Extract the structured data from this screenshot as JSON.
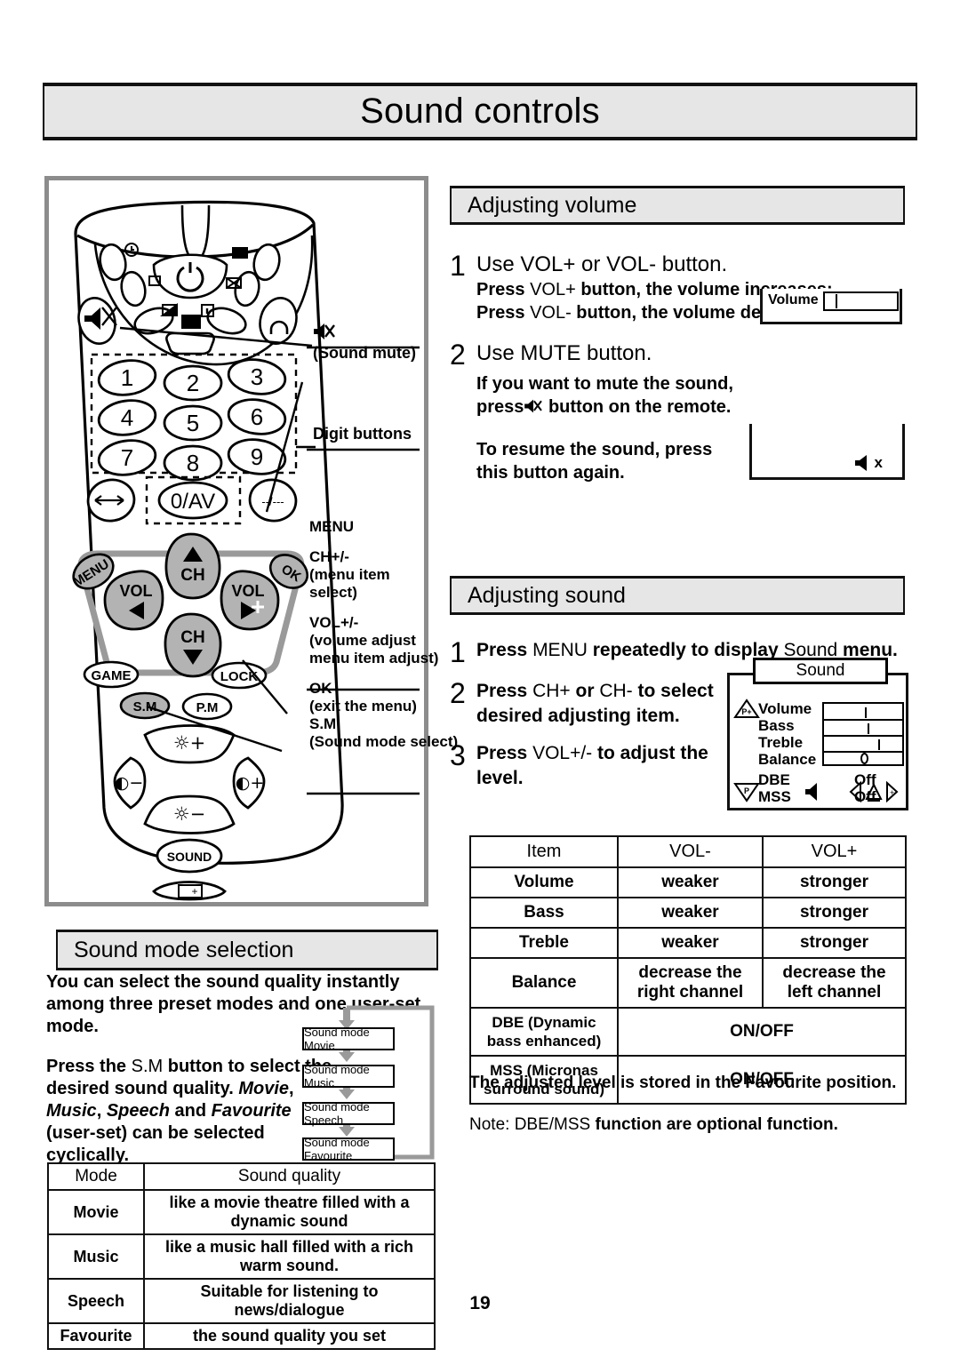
{
  "page": {
    "title": "Sound controls",
    "number": "19"
  },
  "remote": {
    "panel_name": "remote-control-diagram",
    "digits": [
      "1",
      "2",
      "3",
      "4",
      "5",
      "6",
      "7",
      "8",
      "9"
    ],
    "zero_av": "0/AV",
    "dash_button": "--/---",
    "nav": {
      "menu": "MENU",
      "ok": "OK",
      "ch_up": "CH",
      "ch_down": "CH",
      "vol_left": "VOL",
      "vol_right": "VOL"
    },
    "small_buttons": {
      "game": "GAME",
      "lock": "LOCK",
      "sm": "S.M",
      "pm": "P.M",
      "sound": "SOUND"
    },
    "picture_buttons": {
      "bright_up": "☼+",
      "bright_down": "☼−",
      "contrast_down": "◐−",
      "contrast_up": "◐+"
    },
    "callouts": [
      {
        "icon": "sound-mute-icon",
        "label": "(Sound mute)"
      },
      {
        "label": "Digit buttons"
      },
      {
        "label": "MENU"
      },
      {
        "label": "CH+/-",
        "sub": [
          "(menu item",
          "select)"
        ]
      },
      {
        "label": "VOL+/-",
        "sub": [
          "(volume adjust",
          "menu item adjust)"
        ]
      },
      {
        "label": "OK",
        "sub": [
          "(exit the menu)"
        ]
      },
      {
        "label": "S.M",
        "sub": [
          "(Sound mode select)"
        ]
      }
    ]
  },
  "adjusting_volume": {
    "heading": "Adjusting volume",
    "steps": [
      {
        "num": "1",
        "line1": "Use VOL+ or VOL- button.",
        "line2_a": "Press ",
        "line2_b": "VOL+",
        "line2_c": " button, the volume increases;",
        "line3_a": "Press ",
        "line3_b": "VOL-",
        "line3_c": " button, the volume decreases."
      },
      {
        "num": "2",
        "line1": "Use MUTE button.",
        "line2": "If you want to mute the sound,",
        "line3_a": "press",
        "line3_b": "button on the remote.",
        "line4": "To resume the sound, press",
        "line5": "this button again."
      }
    ],
    "osd_volume_label": "Volume",
    "osd_mute_label": "x"
  },
  "adjusting_sound": {
    "heading": "Adjusting sound",
    "steps": [
      {
        "num": "1",
        "a": "Press ",
        "b": "MENU",
        "c": " repeatedly to display ",
        "d": "Sound",
        "e": " menu."
      },
      {
        "num": "2",
        "a": "Press ",
        "b": "CH+",
        "c": " or ",
        "d": "CH-",
        "e": " to select",
        "f": "desired adjusting item."
      },
      {
        "num": "3",
        "a": "Press ",
        "b": "VOL+/-",
        "c": " to adjust the",
        "f": "level."
      }
    ],
    "osd": {
      "title": "Sound",
      "items": [
        "Volume",
        "Bass",
        "Treble",
        "Balance"
      ],
      "slider_positions": [
        52,
        55,
        68,
        50
      ],
      "dbe_label": "DBE",
      "mss_label": "MSS",
      "dbe_value": "Off",
      "mss_value": "Off",
      "p_up": "P+",
      "p_down": "P"
    }
  },
  "vol_table": {
    "headers": [
      "Item",
      "VOL-",
      "VOL+"
    ],
    "rows": [
      {
        "item": "Volume",
        "minus": "weaker",
        "plus": "stronger"
      },
      {
        "item": "Bass",
        "minus": "weaker",
        "plus": "stronger"
      },
      {
        "item": "Treble",
        "minus": "weaker",
        "plus": "stronger"
      },
      {
        "item": "Balance",
        "minus": "decrease the\nright channel",
        "plus": "decrease the\nleft channel"
      },
      {
        "item": "DBE (Dynamic\nbass enhanced)",
        "span": "ON/OFF"
      },
      {
        "item": "MSS (Micronas\nsurround sound)",
        "span": "ON/OFF"
      }
    ]
  },
  "notes": {
    "note1": "The adjusted level is stored in the Favourite position.",
    "note2_a": "Note: DBE/MSS ",
    "note2_b": "function are optional function."
  },
  "sound_mode_selection": {
    "heading": "Sound mode selection",
    "para1": "You can select the sound quality instantly among three preset modes and one user-set mode.",
    "para2_a": "Press the ",
    "para2_b": "S.M",
    "para2_c": " button to select the desired sound quality. ",
    "para2_d": "Movie",
    "para2_e": ", ",
    "para2_f": "Music",
    "para2_g": ", ",
    "para2_h": "Speech",
    "para2_i": " and ",
    "para2_j": "Favourite",
    "para2_k": " (user-set) can be selected cyclically.",
    "flow": [
      "Sound mode Movie",
      "Sound mode Music",
      "Sound mode Speech",
      "Sound mode Favourite"
    ]
  },
  "mode_table": {
    "headers": [
      "Mode",
      "Sound quality"
    ],
    "rows": [
      {
        "mode": "Movie",
        "quality": "like a movie theatre filled with a dynamic sound"
      },
      {
        "mode": "Music",
        "quality": "like a music hall filled with a rich warm sound."
      },
      {
        "mode": "Speech",
        "quality": "Suitable for listening to news/dialogue"
      },
      {
        "mode": "Favourite",
        "quality": "the sound quality you set"
      }
    ]
  },
  "colors": {
    "header_fill": "#e6e6e6",
    "panel_border": "#8c8c8c",
    "button_fill": "#b3b3b3",
    "ink": "#111111"
  }
}
